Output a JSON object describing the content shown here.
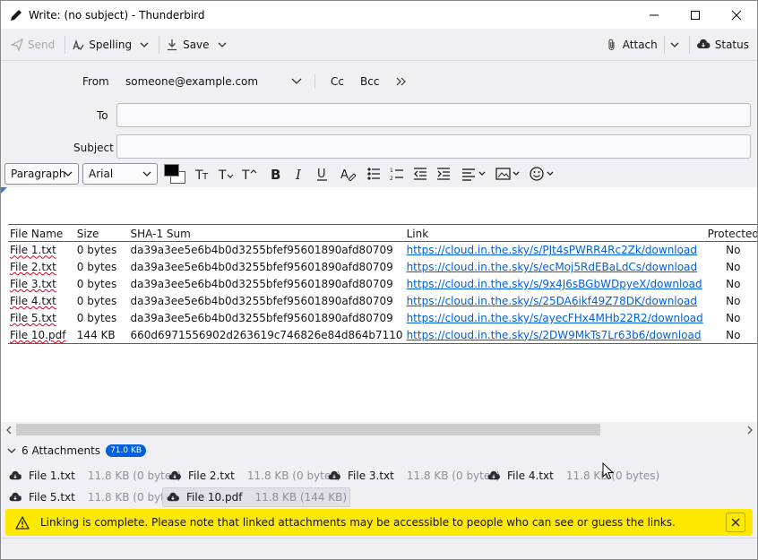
{
  "window": {
    "title": "Write: (no subject) - Thunderbird"
  },
  "toolbar": {
    "send_label": "Send",
    "spelling_label": "Spelling",
    "save_label": "Save",
    "attach_label": "Attach",
    "status_label": "Status"
  },
  "header": {
    "from_label": "From",
    "from_value": "someone@example.com",
    "cc_label": "Cc",
    "bcc_label": "Bcc",
    "to_label": "To",
    "to_value": "",
    "subject_label": "Subject",
    "subject_value": ""
  },
  "format": {
    "paragraph": "Paragraph",
    "font": "Arial",
    "text_color": "#000000",
    "bg_color": "#ffffff"
  },
  "table": {
    "headers": [
      "File Name",
      "Size",
      "SHA-1 Sum",
      "Link",
      "Protected"
    ],
    "rows": [
      [
        "File 1.txt",
        "0 bytes",
        "da39a3ee5e6b4b0d3255bfef95601890afd80709",
        "https://cloud.in.the.sky/s/PJt4sPWRR4Rc2Zk/download",
        "No"
      ],
      [
        "File 2.txt",
        "0 bytes",
        "da39a3ee5e6b4b0d3255bfef95601890afd80709",
        "https://cloud.in.the.sky/s/ecMoj5RdEBaLdCs/download",
        "No"
      ],
      [
        "File 3.txt",
        "0 bytes",
        "da39a3ee5e6b4b0d3255bfef95601890afd80709",
        "https://cloud.in.the.sky/s/9x4J6sBGbWDpyeX/download",
        "No"
      ],
      [
        "File 4.txt",
        "0 bytes",
        "da39a3ee5e6b4b0d3255bfef95601890afd80709",
        "https://cloud.in.the.sky/s/25DA6ikf49Z78DK/download",
        "No"
      ],
      [
        "File 5.txt",
        "0 bytes",
        "da39a3ee5e6b4b0d3255bfef95601890afd80709",
        "https://cloud.in.the.sky/s/ayecFHx4MHb22R2/download",
        "No"
      ],
      [
        "File 10.pdf",
        "144 KB",
        "660d6971556902d263619c746826e84d864b7110",
        "https://cloud.in.the.sky/s/2DW9MkTs7Lr63b6/download",
        "No"
      ]
    ]
  },
  "attachments": {
    "header": "6 Attachments",
    "total": "71.0 KB",
    "items": [
      {
        "name": "File 1.txt",
        "size": "11.8 KB (0 bytes)"
      },
      {
        "name": "File 2.txt",
        "size": "11.8 KB (0 bytes)"
      },
      {
        "name": "File 3.txt",
        "size": "11.8 KB (0 bytes)"
      },
      {
        "name": "File 4.txt",
        "size": "11.8 KB (0 bytes)"
      },
      {
        "name": "File 5.txt",
        "size": "11.8 KB (0 bytes)"
      },
      {
        "name": "File 10.pdf",
        "size": "11.8 KB (144 KB)"
      }
    ]
  },
  "notification": {
    "message": "Linking is complete. Please note that linked attachments may be accessible to people who can see or guess the links."
  }
}
